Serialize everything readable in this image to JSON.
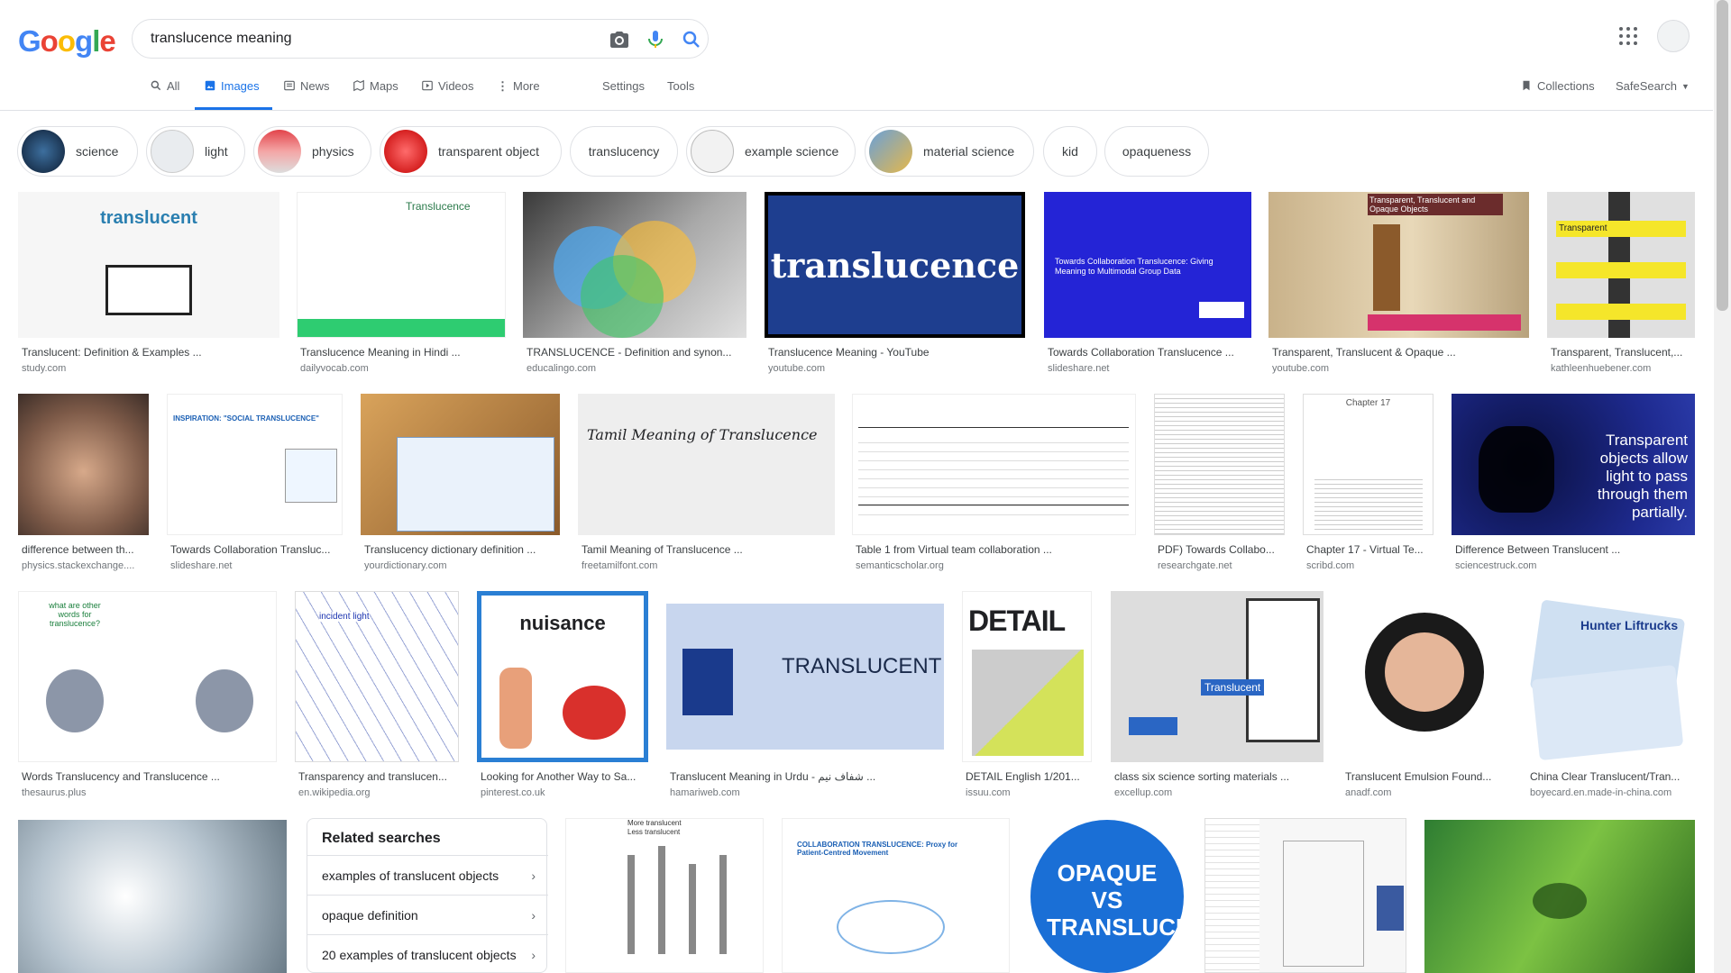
{
  "logo": "Google",
  "search": {
    "query": "translucence meaning"
  },
  "tabs": [
    {
      "label": "All",
      "icon": "search-icon"
    },
    {
      "label": "Images",
      "icon": "image-icon"
    },
    {
      "label": "News",
      "icon": "news-icon"
    },
    {
      "label": "Maps",
      "icon": "map-icon"
    },
    {
      "label": "Videos",
      "icon": "video-icon"
    },
    {
      "label": "More",
      "icon": "more-vert-icon"
    },
    {
      "label": "Settings"
    },
    {
      "label": "Tools"
    }
  ],
  "collections": "Collections",
  "safesearch": "SafeSearch",
  "chips": [
    "science",
    "light",
    "physics",
    "transparent object",
    "translucency",
    "example science",
    "material science",
    "kid",
    "opaqueness"
  ],
  "rows": [
    [
      {
        "title": "Translucent: Definition & Examples ...",
        "source": "study.com",
        "text": "translucent"
      },
      {
        "title": "Translucence Meaning in Hindi ...",
        "source": "dailyvocab.com",
        "text": "Translucence"
      },
      {
        "title": "TRANSLUCENCE - Definition and synon...",
        "source": "educalingo.com",
        "text": ""
      },
      {
        "title": "Translucence Meaning - YouTube",
        "source": "youtube.com",
        "text": "translucence"
      },
      {
        "title": "Towards Collaboration Translucence ...",
        "source": "slideshare.net",
        "text": "Towards Collaboration Translucence: Giving Meaning to Multimodal Group Data"
      },
      {
        "title": "Transparent, Translucent & Opaque ...",
        "source": "youtube.com",
        "text": "Transparent, Translucent and Opaque Objects"
      },
      {
        "title": "Transparent, Translucent,...",
        "source": "kathleenhuebener.com",
        "text": "Transparent"
      }
    ],
    [
      {
        "title": "difference between th...",
        "source": "physics.stackexchange....",
        "text": ""
      },
      {
        "title": "Towards Collaboration Transluc...",
        "source": "slideshare.net",
        "text": "INSPIRATION: \"SOCIAL TRANSLUCENCE\""
      },
      {
        "title": "Translucency dictionary definition ...",
        "source": "yourdictionary.com",
        "text": ""
      },
      {
        "title": "Tamil Meaning of Translucence ...",
        "source": "freetamilfont.com",
        "text": "Tamil Meaning of Translucence"
      },
      {
        "title": "Table 1 from Virtual team collaboration ...",
        "source": "semanticscholar.org",
        "text": ""
      },
      {
        "title": "PDF) Towards Collabo...",
        "source": "researchgate.net",
        "text": ""
      },
      {
        "title": "Chapter 17 - Virtual Te...",
        "source": "scribd.com",
        "text": "Chapter 17"
      },
      {
        "title": "Difference Between Translucent ...",
        "source": "sciencestruck.com",
        "text": "Transparent objects allow light to pass through them partially."
      }
    ],
    [
      {
        "title": "Words Translucency and Translucence ...",
        "source": "thesaurus.plus",
        "text": "what are other words for translucence?"
      },
      {
        "title": "Transparency and translucen...",
        "source": "en.wikipedia.org",
        "text": "incident light"
      },
      {
        "title": "Looking for Another Way to Sa...",
        "source": "pinterest.co.uk",
        "text": "nuisance"
      },
      {
        "title": "Translucent Meaning in Urdu - شفاف نیم ...",
        "source": "hamariweb.com",
        "text": "TRANSLUCENT"
      },
      {
        "title": "DETAIL English 1/201...",
        "source": "issuu.com",
        "text": "DETAIL"
      },
      {
        "title": "class six science sorting materials ...",
        "source": "excellup.com",
        "text": "Translucent"
      },
      {
        "title": "Translucent Emulsion Found...",
        "source": "anadf.com",
        "text": ""
      },
      {
        "title": "China Clear Translucent/Tran...",
        "source": "boyecard.en.made-in-china.com",
        "text": "Hunter Liftrucks"
      }
    ]
  ],
  "related": {
    "heading": "Related searches",
    "items": [
      "examples of translucent objects",
      "opaque definition",
      "20 examples of translucent objects"
    ]
  },
  "bottom": {
    "chart_legend": [
      "More translucent",
      "Less translucent"
    ],
    "badge_text": "OPAQUE VS TRANSLUCENT",
    "collab_text": "COLLABORATION TRANSLUCENCE: Proxy for Patient-Centred Movement"
  }
}
